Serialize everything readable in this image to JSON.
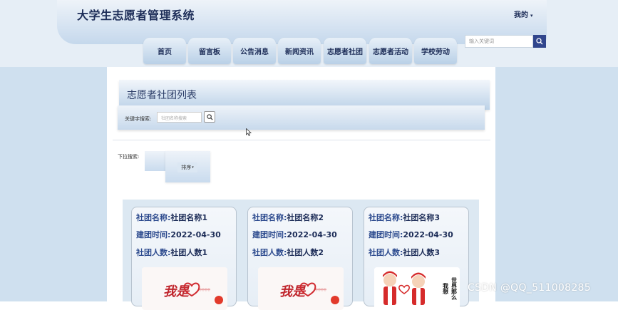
{
  "header": {
    "site_title": "大学生志愿者管理系统",
    "my_menu": "我的",
    "caret": "▾"
  },
  "nav": {
    "tabs": [
      "首页",
      "留言板",
      "公告消息",
      "新闻资讯",
      "志愿者社团",
      "志愿者活动",
      "学校劳动"
    ]
  },
  "top_search": {
    "placeholder": "输入关键词"
  },
  "list": {
    "title": "志愿者社团列表",
    "keyword_label": "关键字搜索:",
    "keyword_placeholder": "社团名称搜索",
    "dropdown_label": "下拉搜索:",
    "sort_label": "排序",
    "sort_caret": "▾"
  },
  "cards": [
    {
      "name_key": "社团名称:",
      "name": "社团名称1",
      "date_key": "建团时间:",
      "date": "2022-04-30",
      "count_key": "社团人数:",
      "count": "社团人数1"
    },
    {
      "name_key": "社团名称:",
      "name": "社团名称2",
      "date_key": "建团时间:",
      "date": "2022-04-30",
      "count_key": "社团人数:",
      "count": "社团人数2"
    },
    {
      "name_key": "社团名称:",
      "name": "社团名称3",
      "date_key": "建团时间:",
      "date": "2022-04-30",
      "count_key": "社团人数:",
      "count": "社团人数3"
    }
  ],
  "card_images": {
    "poster_text": "我是",
    "poster_small": "中中中中",
    "vertical_text_1": "世界那么",
    "vertical_text_2": "我想"
  },
  "watermark": "CSDN @QQ_511008285",
  "icons": {
    "search": "search-icon",
    "cursor": "cursor-icon"
  }
}
